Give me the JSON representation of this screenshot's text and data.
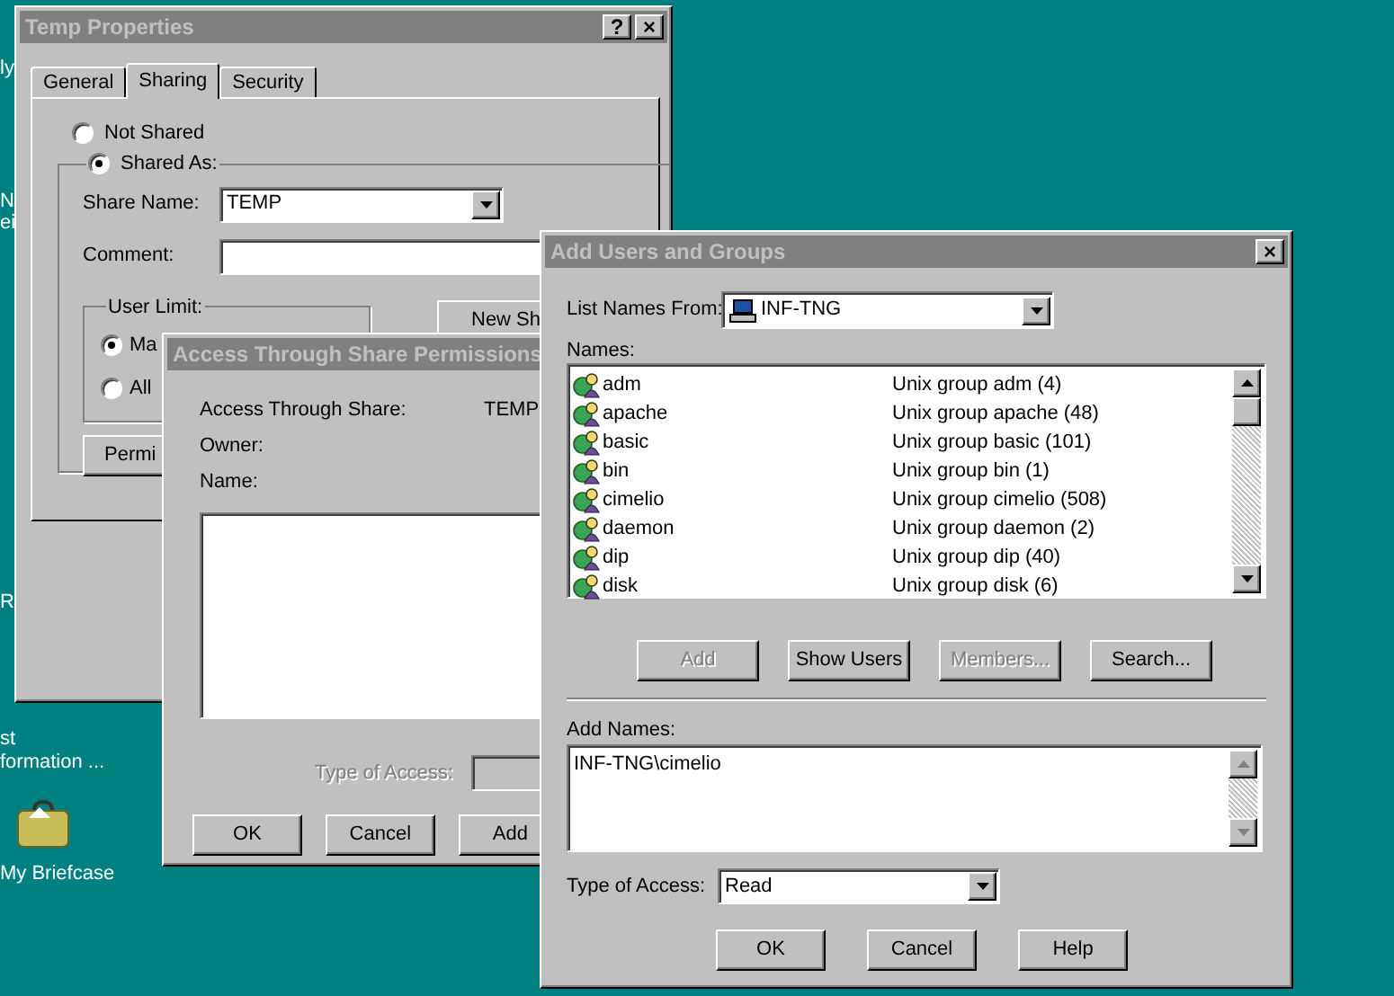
{
  "desktop": {
    "labels": [
      "ly",
      "N",
      "ei",
      "R",
      "st",
      "formation ...",
      "My Briefcase"
    ]
  },
  "temp_properties": {
    "title": "Temp Properties",
    "help_button": "?",
    "close_button": "×",
    "tabs": [
      {
        "label": "General",
        "selected": false
      },
      {
        "label": "Sharing",
        "selected": true
      },
      {
        "label": "Security",
        "selected": false
      }
    ],
    "not_shared": {
      "label": "Not Shared",
      "selected": false
    },
    "shared_as": {
      "label": "Shared As:",
      "selected": true
    },
    "share_name": {
      "label": "Share Name:",
      "value": "TEMP"
    },
    "comment": {
      "label": "Comment:"
    },
    "user_limit": {
      "label": "User Limit:",
      "options": [
        {
          "label": "Ma",
          "selected": true
        },
        {
          "label": "All",
          "selected": false
        }
      ]
    },
    "new_share_button": "New Sh",
    "permissions_button": "Permi"
  },
  "access_permissions": {
    "title": "Access Through Share Permissions",
    "fields": [
      {
        "label": "Access Through Share:",
        "value": "TEMP"
      },
      {
        "label": "Owner:"
      },
      {
        "label": "Name:"
      }
    ],
    "type_of_access": {
      "label": "Type of Access:",
      "disabled": true
    },
    "buttons": [
      {
        "label": "OK"
      },
      {
        "label": "Cancel"
      },
      {
        "label": "Add"
      }
    ]
  },
  "add_users": {
    "title": "Add Users and Groups",
    "close_button": "×",
    "list_names_from": {
      "label": "List Names From:",
      "value": "INF-TNG"
    },
    "names_label": "Names:",
    "names": [
      {
        "name": "adm",
        "description": "Unix group adm (4)"
      },
      {
        "name": "apache",
        "description": "Unix group apache (48)"
      },
      {
        "name": "basic",
        "description": "Unix group basic (101)"
      },
      {
        "name": "bin",
        "description": "Unix group bin (1)"
      },
      {
        "name": "cimelio",
        "description": "Unix group cimelio (508)"
      },
      {
        "name": "daemon",
        "description": "Unix group daemon (2)"
      },
      {
        "name": "dip",
        "description": "Unix group dip (40)"
      },
      {
        "name": "disk",
        "description": "Unix group disk (6)"
      }
    ],
    "buttons": [
      {
        "label": "Add",
        "disabled": true
      },
      {
        "label": "Show Users",
        "disabled": false
      },
      {
        "label": "Members...",
        "disabled": true
      },
      {
        "label": "Search...",
        "disabled": false
      }
    ],
    "add_names": {
      "label": "Add Names:",
      "value": "INF-TNG\\cimelio"
    },
    "type_of_access": {
      "label": "Type of Access:",
      "value": "Read"
    },
    "footer_buttons": [
      {
        "label": "OK"
      },
      {
        "label": "Cancel"
      },
      {
        "label": "Help"
      }
    ]
  }
}
